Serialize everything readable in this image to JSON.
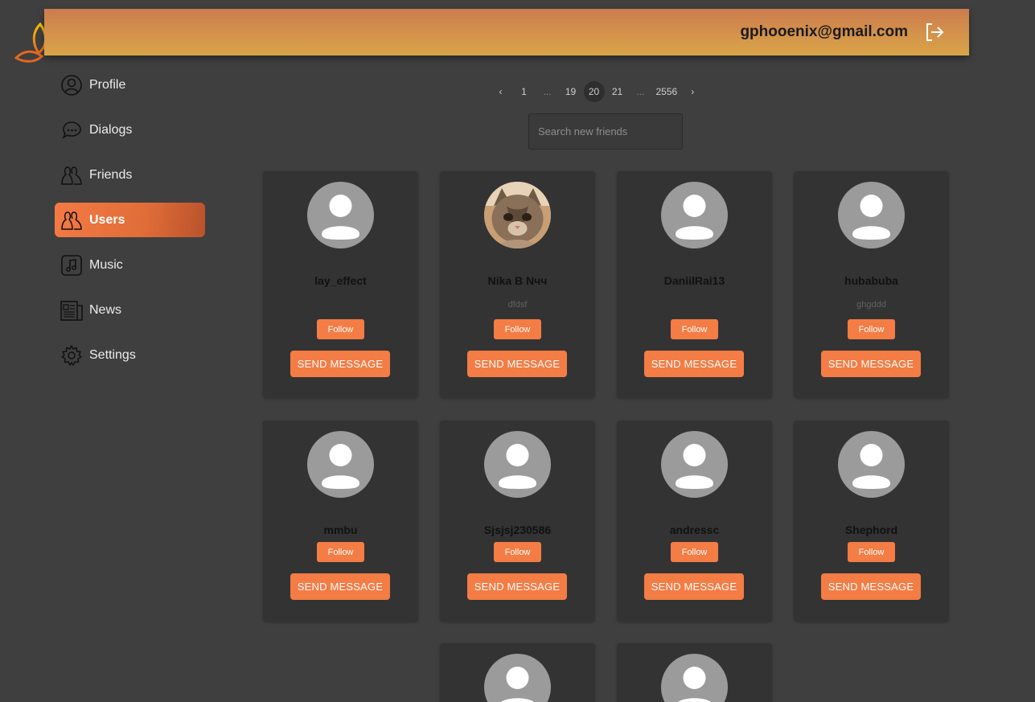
{
  "header": {
    "email": "gphooenix@gmail.com",
    "logo_icon": "flame-logo-icon",
    "logout_icon": "logout-icon",
    "gradient": [
      "#cd7c4e",
      "#d9a548"
    ]
  },
  "sidebar": {
    "items": [
      {
        "label": "Profile",
        "icon": "user-circle-icon",
        "active": false
      },
      {
        "label": "Dialogs",
        "icon": "chat-bubbles-icon",
        "active": false
      },
      {
        "label": "Friends",
        "icon": "friends-icon",
        "active": false
      },
      {
        "label": "Users",
        "icon": "users-icon",
        "active": true
      },
      {
        "label": "Music",
        "icon": "music-note-icon",
        "active": false
      },
      {
        "label": "News",
        "icon": "newspaper-icon",
        "active": false
      },
      {
        "label": "Settings",
        "icon": "gear-icon",
        "active": false
      }
    ],
    "active_color": "#f47a44"
  },
  "pagination": {
    "prev": "‹",
    "next": "›",
    "pages": [
      "1",
      "...",
      "19",
      "20",
      "21",
      "...",
      "2556"
    ],
    "current": "20"
  },
  "search": {
    "placeholder": "Search new friends",
    "value": ""
  },
  "users": [
    {
      "name": "lay_effect",
      "status": "",
      "photo": "default-avatar-icon",
      "follow_label": "Follow",
      "message_label": "SEND MESSAGE"
    },
    {
      "name": "Nika В Nчч",
      "status": "dfdsf",
      "photo": "kitten-photo",
      "follow_label": "Follow",
      "message_label": "SEND MESSAGE"
    },
    {
      "name": "DaniilRai13",
      "status": "",
      "photo": "default-avatar-icon",
      "follow_label": "Follow",
      "message_label": "SEND MESSAGE"
    },
    {
      "name": "hubabuba",
      "status": "ghgddd",
      "photo": "default-avatar-icon",
      "follow_label": "Follow",
      "message_label": "SEND MESSAGE"
    },
    {
      "name": "mmbu",
      "status": "",
      "photo": "default-avatar-icon",
      "follow_label": "Follow",
      "message_label": "SEND MESSAGE"
    },
    {
      "name": "Sjsjsj230586",
      "status": "",
      "photo": "default-avatar-icon",
      "follow_label": "Follow",
      "message_label": "SEND MESSAGE"
    },
    {
      "name": "andressc",
      "status": "",
      "photo": "default-avatar-icon",
      "follow_label": "Follow",
      "message_label": "SEND MESSAGE"
    },
    {
      "name": "Shephord",
      "status": "",
      "photo": "default-avatar-icon",
      "follow_label": "Follow",
      "message_label": "SEND MESSAGE"
    },
    {
      "name": "",
      "status": "",
      "photo": "default-avatar-icon",
      "follow_label": "",
      "message_label": ""
    },
    {
      "name": "",
      "status": "",
      "photo": "default-avatar-icon",
      "follow_label": "",
      "message_label": ""
    }
  ],
  "colors": {
    "background": "#3f3f3f",
    "card": "#333333",
    "accent": "#f47c45",
    "avatar_placeholder": "#9b9b9b"
  }
}
